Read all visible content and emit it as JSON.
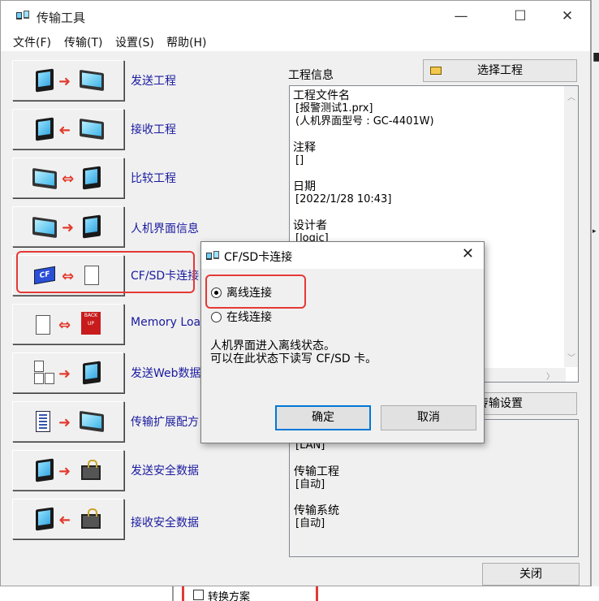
{
  "window": {
    "title": "传输工具",
    "controls": {
      "minimize": "—",
      "maximize": "☐",
      "close": "✕"
    }
  },
  "menu": [
    "文件(F)",
    "传输(T)",
    "设置(S)",
    "帮助(H)"
  ],
  "tools": [
    {
      "label": "发送工程",
      "icon": "send-project-icon"
    },
    {
      "label": "接收工程",
      "icon": "receive-project-icon"
    },
    {
      "label": "比较工程",
      "icon": "compare-project-icon"
    },
    {
      "label": "人机界面信息",
      "icon": "hmi-info-icon"
    },
    {
      "label": "CF/SD卡连接",
      "icon": "cf-sd-connect-icon"
    },
    {
      "label": "Memory Loade",
      "icon": "memory-loader-icon"
    },
    {
      "label": "发送Web数据",
      "icon": "send-web-data-icon"
    },
    {
      "label": "传输扩展配方",
      "icon": "transfer-recipe-icon"
    },
    {
      "label": "发送安全数据",
      "icon": "send-security-data-icon"
    },
    {
      "label": "接收安全数据",
      "icon": "receive-security-data-icon"
    }
  ],
  "project_info": {
    "label": "工程信息",
    "select_button": "选择工程",
    "file_name_title": "工程文件名",
    "file_name": "[报警测试1.prx]",
    "model": "(人机界面型号 : GC-4401W)",
    "comment_title": "注释",
    "comment": "[]",
    "date_title": "日期",
    "date": "[2022/1/28 10:43]",
    "designer_title": "设计者",
    "designer": "[logic]"
  },
  "transfer": {
    "settings_button": "传输设置",
    "port": "[LAN]",
    "project_title": "传输工程",
    "project": "[自动]",
    "system_title": "传输系统",
    "system": "[自动]"
  },
  "close_button": "关闭",
  "dialog": {
    "title": "CF/SD卡连接",
    "close": "✕",
    "options": [
      {
        "label": "离线连接",
        "selected": true
      },
      {
        "label": "在线连接",
        "selected": false
      }
    ],
    "message_line1": "人机界面进入离线状态。",
    "message_line2": "可以在此状态下读写 CF/SD 卡。",
    "ok": "确定",
    "cancel": "取消"
  },
  "background": {
    "bottom_text": "转换方案"
  },
  "colors": {
    "highlight": "#e53935",
    "link_text": "#1a1aa0",
    "default_button_border": "#0078d7"
  }
}
